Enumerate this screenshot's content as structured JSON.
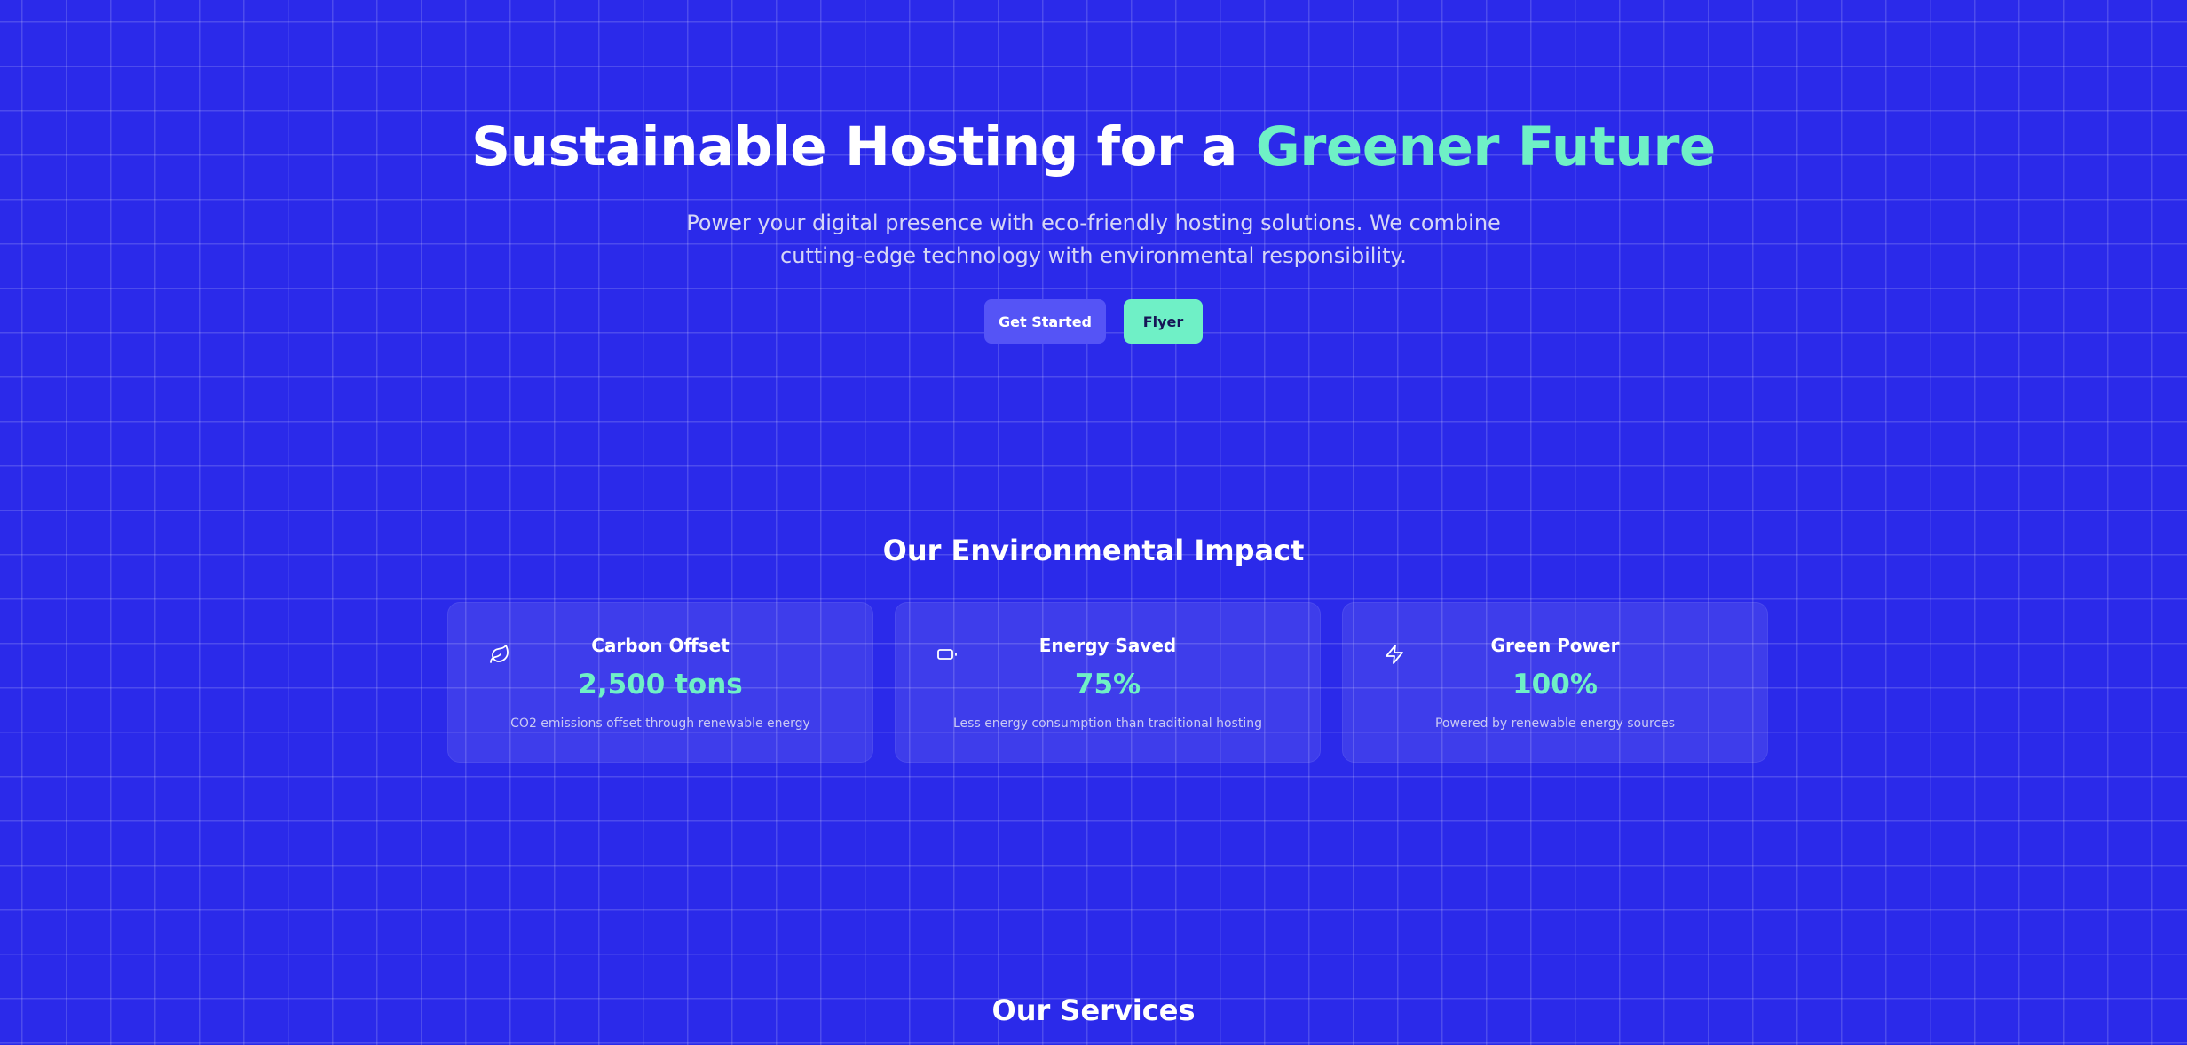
{
  "hero": {
    "title_main": "Sustainable Hosting for a ",
    "title_accent": "Greener Future",
    "subtitle": "Power your digital presence with eco-friendly hosting solutions. We combine cutting-edge technology with environmental responsibility.",
    "primary_button": "Get Started",
    "secondary_button": "Flyer"
  },
  "impact": {
    "title": "Our Environmental Impact",
    "cards": [
      {
        "icon": "leaf-icon",
        "title": "Carbon Offset",
        "value": "2,500 tons",
        "description": "CO2 emissions offset through renewable energy"
      },
      {
        "icon": "battery-icon",
        "title": "Energy Saved",
        "value": "75%",
        "description": "Less energy consumption than traditional hosting"
      },
      {
        "icon": "lightning-bolt-icon",
        "title": "Green Power",
        "value": "100%",
        "description": "Powered by renewable energy sources"
      }
    ]
  },
  "services": {
    "title": "Our Services"
  },
  "colors": {
    "background": "#2b2aea",
    "accent": "#6ff0c6",
    "primary_button": "#5554f6"
  }
}
